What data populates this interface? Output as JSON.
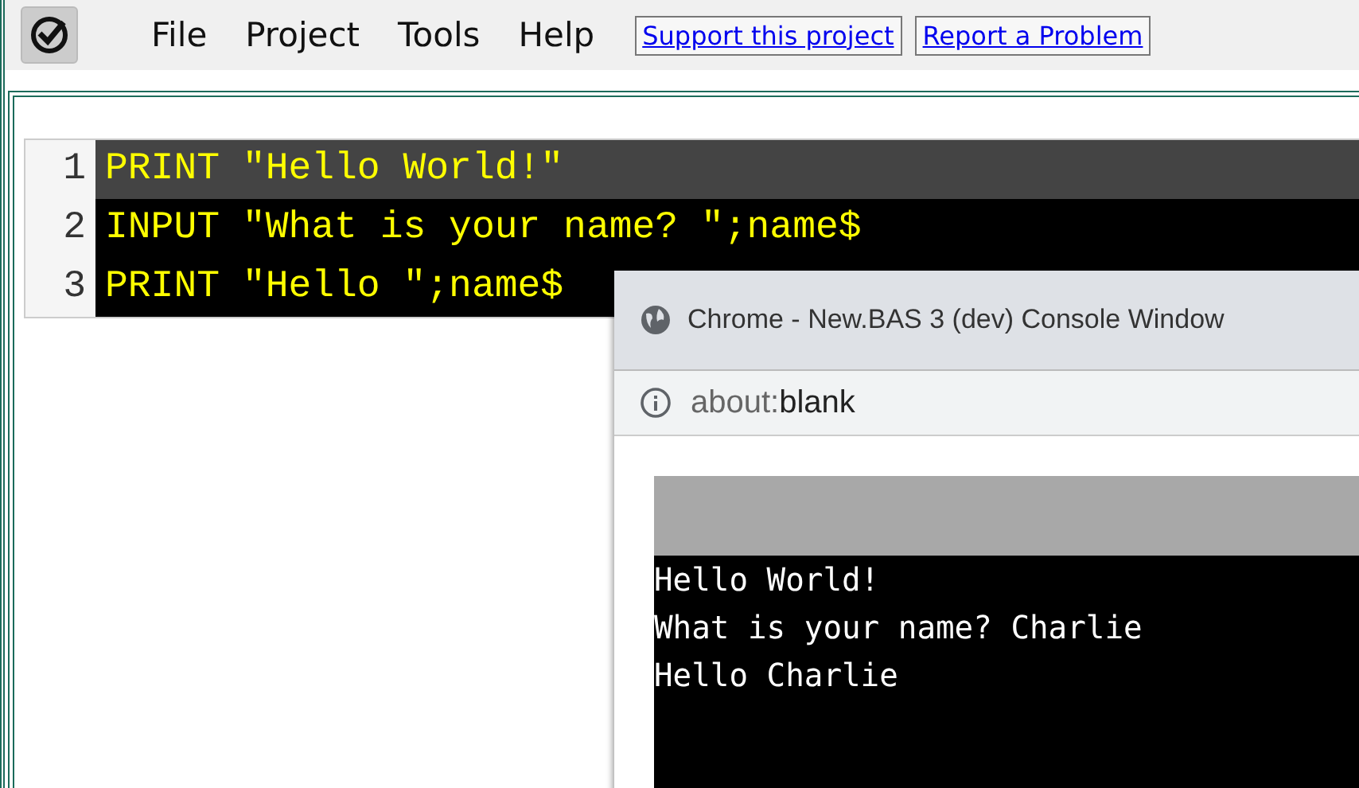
{
  "menu": [
    "File",
    "Project",
    "Tools",
    "Help"
  ],
  "links": [
    "Support this project",
    "Report a Problem"
  ],
  "editor": {
    "lines": [
      {
        "number": "1",
        "code": "PRINT \"Hello World!\"",
        "selected": true
      },
      {
        "number": "2",
        "code": "INPUT \"What is your name? \";name$",
        "selected": false
      },
      {
        "number": "3",
        "code": "PRINT \"Hello \";name$",
        "selected": false
      }
    ]
  },
  "console_window": {
    "title": "Chrome - New.BAS 3 (dev) Console Window",
    "url_scheme": "about:",
    "url_page": "blank",
    "output": [
      "Hello World!",
      "What is your name? Charlie",
      "Hello Charlie"
    ]
  }
}
